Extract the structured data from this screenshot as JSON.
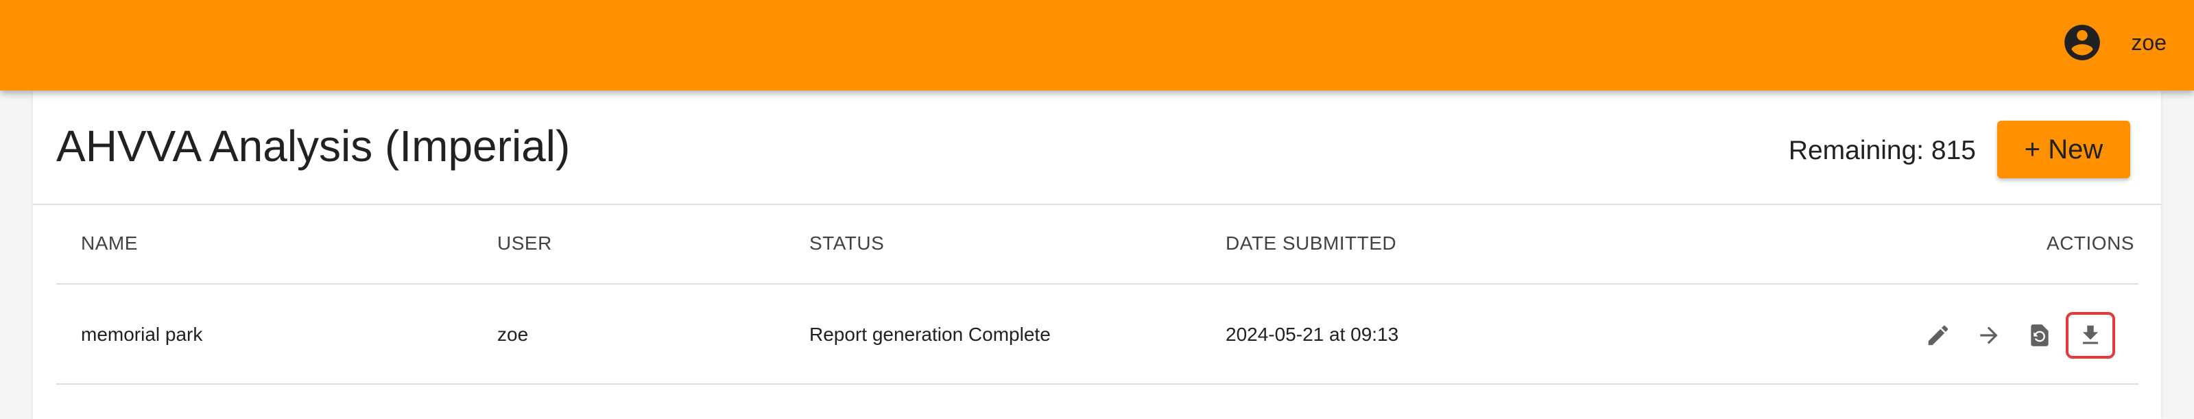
{
  "header": {
    "user_icon": "account-circle-icon",
    "username": "zoe",
    "bar_color": "#ff9100"
  },
  "page": {
    "title": "AHVVA Analysis (Imperial)",
    "remaining_label": "Remaining: 815",
    "new_button_label": "+ New"
  },
  "table": {
    "columns": [
      "NAME",
      "USER",
      "STATUS",
      "DATE SUBMITTED",
      "ACTIONS"
    ],
    "rows": [
      {
        "name": "memorial park",
        "user": "zoe",
        "status": "Report generation Complete",
        "date_submitted": "2024-05-21 at 09:13",
        "actions": [
          "edit-icon",
          "arrow-forward-icon",
          "report-restore-icon",
          "download-icon"
        ],
        "highlighted_action": "download-icon"
      }
    ]
  },
  "colors": {
    "accent": "#ff9100",
    "highlight_border": "#e53935",
    "icon": "#616161"
  }
}
